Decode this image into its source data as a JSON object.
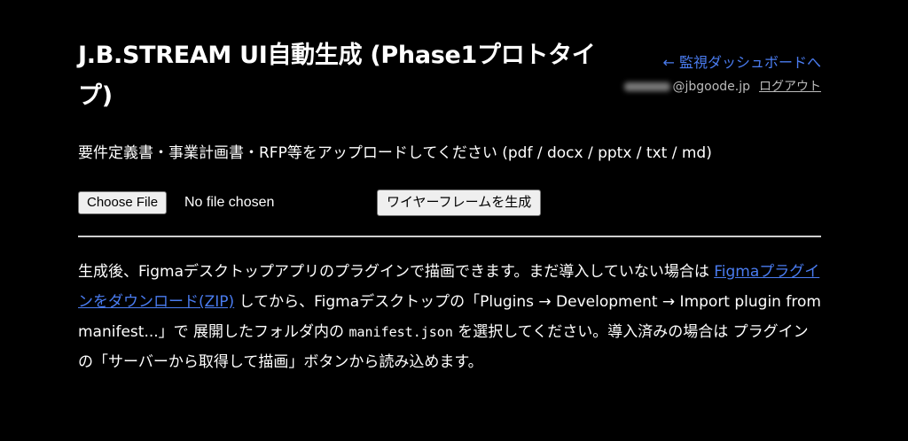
{
  "header": {
    "title": "J.B.STREAM UI自動生成 (Phase1プロトタイプ)",
    "dashboard_link": "← 監視ダッシュボードへ",
    "user_email_domain": "@jbgoode.jp",
    "logout_link": "ログアウト"
  },
  "upload": {
    "instruction": "要件定義書・事業計画書・RFP等をアップロードしてください (pdf / docx / pptx / txt / md)",
    "choose_file_label": "Choose File",
    "file_status": "No file chosen",
    "generate_button": "ワイヤーフレームを生成"
  },
  "description": {
    "part1": "生成後、Figmaデスクトップアプリのプラグインで描画できます。まだ導入していない場合は ",
    "plugin_link": "Figmaプラグインをダウンロード(ZIP)",
    "part2": " してから、Figmaデスクトップの「Plugins → Development → Import plugin from manifest...」で 展開したフォルダ内の ",
    "manifest_file": "manifest.json",
    "part3": " を選択してください。導入済みの場合は プラグインの「サーバーから取得して描画」ボタンから読み込めます。"
  },
  "colors": {
    "background": "#000000",
    "text": "#ffffff",
    "link": "#4a7cf0",
    "muted": "#bbbbbb"
  }
}
